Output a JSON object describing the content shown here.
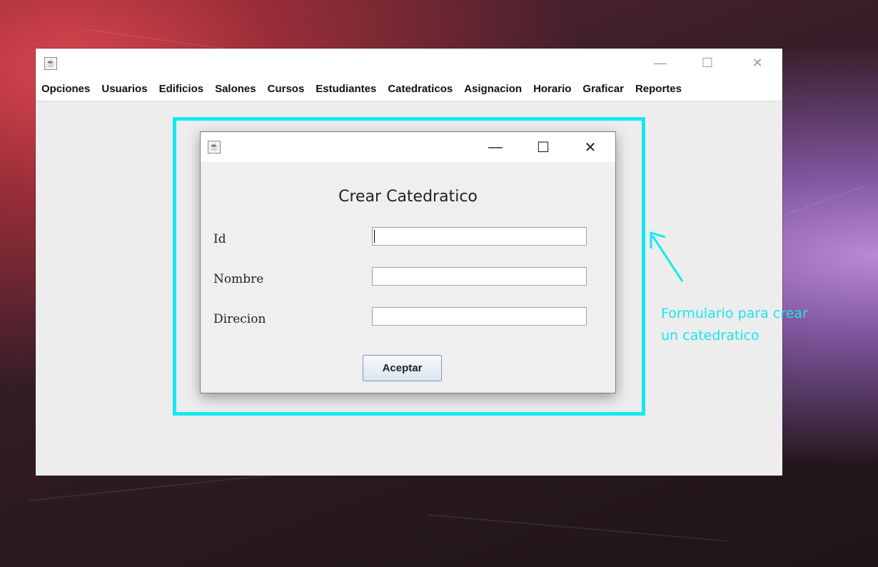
{
  "main_window": {
    "title": "",
    "menu": [
      "Opciones",
      "Usuarios",
      "Edificios",
      "Salones",
      "Cursos",
      "Estudiantes",
      "Catedraticos",
      "Asignacion",
      "Horario",
      "Graficar",
      "Reportes"
    ],
    "controls": {
      "minimize": "—",
      "maximize": "☐",
      "close": "✕"
    }
  },
  "dialog": {
    "title": "Crear Catedratico",
    "controls": {
      "minimize": "—",
      "maximize": "☐",
      "close": "✕"
    },
    "fields": [
      {
        "label": "Id",
        "value": "",
        "placeholder": ""
      },
      {
        "label": "Nombre",
        "value": "",
        "placeholder": ""
      },
      {
        "label": "Direcion",
        "value": "",
        "placeholder": ""
      }
    ],
    "accept_label": "Aceptar"
  },
  "annotation": {
    "line1": "Formulario para crear",
    "line2": "un catedratico",
    "color": "#14e9f0"
  },
  "icons": {
    "app": "java-icon",
    "arrow": "pointer-arrow-icon"
  }
}
